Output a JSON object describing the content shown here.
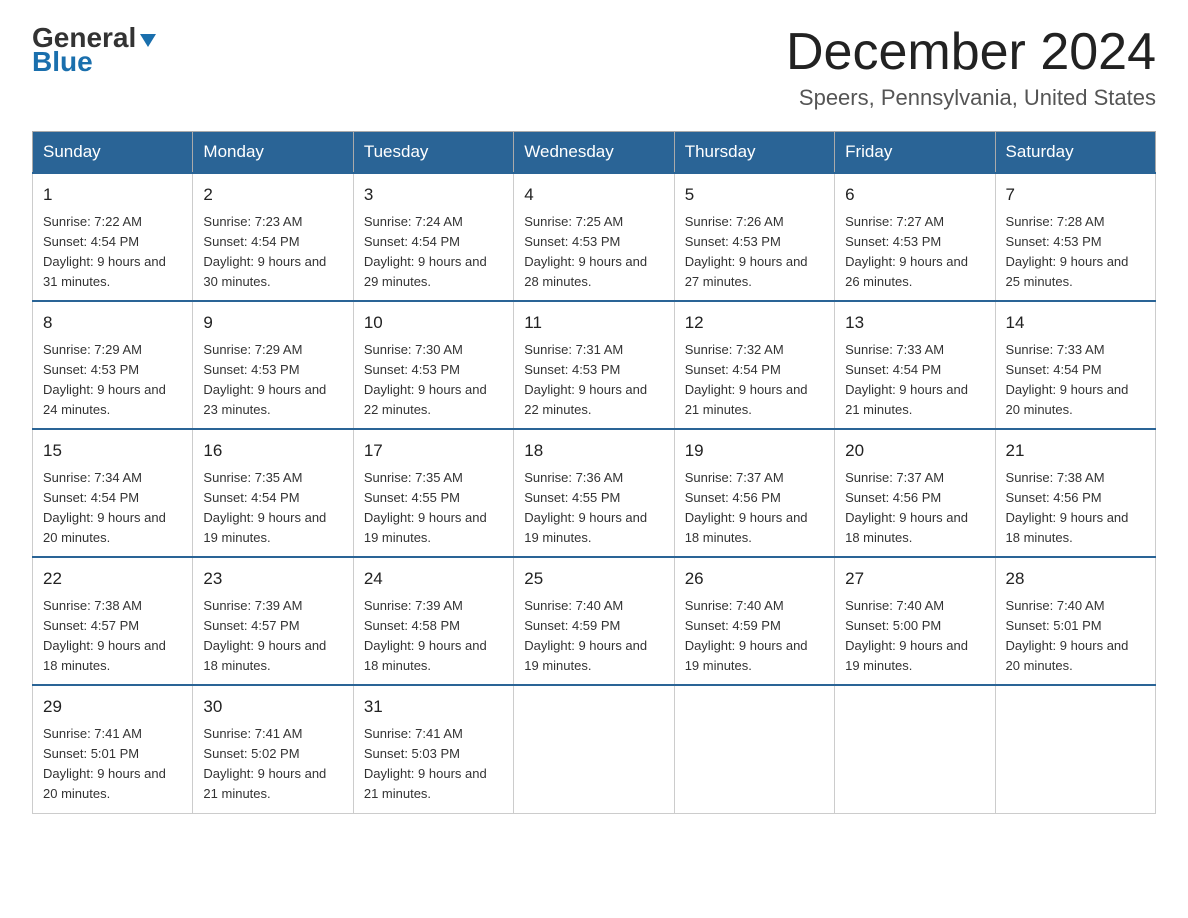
{
  "logo": {
    "general": "General",
    "blue": "Blue",
    "arrow": "▼"
  },
  "title": "December 2024",
  "location": "Speers, Pennsylvania, United States",
  "days_of_week": [
    "Sunday",
    "Monday",
    "Tuesday",
    "Wednesday",
    "Thursday",
    "Friday",
    "Saturday"
  ],
  "weeks": [
    [
      {
        "day": "1",
        "sunrise": "Sunrise: 7:22 AM",
        "sunset": "Sunset: 4:54 PM",
        "daylight": "Daylight: 9 hours and 31 minutes."
      },
      {
        "day": "2",
        "sunrise": "Sunrise: 7:23 AM",
        "sunset": "Sunset: 4:54 PM",
        "daylight": "Daylight: 9 hours and 30 minutes."
      },
      {
        "day": "3",
        "sunrise": "Sunrise: 7:24 AM",
        "sunset": "Sunset: 4:54 PM",
        "daylight": "Daylight: 9 hours and 29 minutes."
      },
      {
        "day": "4",
        "sunrise": "Sunrise: 7:25 AM",
        "sunset": "Sunset: 4:53 PM",
        "daylight": "Daylight: 9 hours and 28 minutes."
      },
      {
        "day": "5",
        "sunrise": "Sunrise: 7:26 AM",
        "sunset": "Sunset: 4:53 PM",
        "daylight": "Daylight: 9 hours and 27 minutes."
      },
      {
        "day": "6",
        "sunrise": "Sunrise: 7:27 AM",
        "sunset": "Sunset: 4:53 PM",
        "daylight": "Daylight: 9 hours and 26 minutes."
      },
      {
        "day": "7",
        "sunrise": "Sunrise: 7:28 AM",
        "sunset": "Sunset: 4:53 PM",
        "daylight": "Daylight: 9 hours and 25 minutes."
      }
    ],
    [
      {
        "day": "8",
        "sunrise": "Sunrise: 7:29 AM",
        "sunset": "Sunset: 4:53 PM",
        "daylight": "Daylight: 9 hours and 24 minutes."
      },
      {
        "day": "9",
        "sunrise": "Sunrise: 7:29 AM",
        "sunset": "Sunset: 4:53 PM",
        "daylight": "Daylight: 9 hours and 23 minutes."
      },
      {
        "day": "10",
        "sunrise": "Sunrise: 7:30 AM",
        "sunset": "Sunset: 4:53 PM",
        "daylight": "Daylight: 9 hours and 22 minutes."
      },
      {
        "day": "11",
        "sunrise": "Sunrise: 7:31 AM",
        "sunset": "Sunset: 4:53 PM",
        "daylight": "Daylight: 9 hours and 22 minutes."
      },
      {
        "day": "12",
        "sunrise": "Sunrise: 7:32 AM",
        "sunset": "Sunset: 4:54 PM",
        "daylight": "Daylight: 9 hours and 21 minutes."
      },
      {
        "day": "13",
        "sunrise": "Sunrise: 7:33 AM",
        "sunset": "Sunset: 4:54 PM",
        "daylight": "Daylight: 9 hours and 21 minutes."
      },
      {
        "day": "14",
        "sunrise": "Sunrise: 7:33 AM",
        "sunset": "Sunset: 4:54 PM",
        "daylight": "Daylight: 9 hours and 20 minutes."
      }
    ],
    [
      {
        "day": "15",
        "sunrise": "Sunrise: 7:34 AM",
        "sunset": "Sunset: 4:54 PM",
        "daylight": "Daylight: 9 hours and 20 minutes."
      },
      {
        "day": "16",
        "sunrise": "Sunrise: 7:35 AM",
        "sunset": "Sunset: 4:54 PM",
        "daylight": "Daylight: 9 hours and 19 minutes."
      },
      {
        "day": "17",
        "sunrise": "Sunrise: 7:35 AM",
        "sunset": "Sunset: 4:55 PM",
        "daylight": "Daylight: 9 hours and 19 minutes."
      },
      {
        "day": "18",
        "sunrise": "Sunrise: 7:36 AM",
        "sunset": "Sunset: 4:55 PM",
        "daylight": "Daylight: 9 hours and 19 minutes."
      },
      {
        "day": "19",
        "sunrise": "Sunrise: 7:37 AM",
        "sunset": "Sunset: 4:56 PM",
        "daylight": "Daylight: 9 hours and 18 minutes."
      },
      {
        "day": "20",
        "sunrise": "Sunrise: 7:37 AM",
        "sunset": "Sunset: 4:56 PM",
        "daylight": "Daylight: 9 hours and 18 minutes."
      },
      {
        "day": "21",
        "sunrise": "Sunrise: 7:38 AM",
        "sunset": "Sunset: 4:56 PM",
        "daylight": "Daylight: 9 hours and 18 minutes."
      }
    ],
    [
      {
        "day": "22",
        "sunrise": "Sunrise: 7:38 AM",
        "sunset": "Sunset: 4:57 PM",
        "daylight": "Daylight: 9 hours and 18 minutes."
      },
      {
        "day": "23",
        "sunrise": "Sunrise: 7:39 AM",
        "sunset": "Sunset: 4:57 PM",
        "daylight": "Daylight: 9 hours and 18 minutes."
      },
      {
        "day": "24",
        "sunrise": "Sunrise: 7:39 AM",
        "sunset": "Sunset: 4:58 PM",
        "daylight": "Daylight: 9 hours and 18 minutes."
      },
      {
        "day": "25",
        "sunrise": "Sunrise: 7:40 AM",
        "sunset": "Sunset: 4:59 PM",
        "daylight": "Daylight: 9 hours and 19 minutes."
      },
      {
        "day": "26",
        "sunrise": "Sunrise: 7:40 AM",
        "sunset": "Sunset: 4:59 PM",
        "daylight": "Daylight: 9 hours and 19 minutes."
      },
      {
        "day": "27",
        "sunrise": "Sunrise: 7:40 AM",
        "sunset": "Sunset: 5:00 PM",
        "daylight": "Daylight: 9 hours and 19 minutes."
      },
      {
        "day": "28",
        "sunrise": "Sunrise: 7:40 AM",
        "sunset": "Sunset: 5:01 PM",
        "daylight": "Daylight: 9 hours and 20 minutes."
      }
    ],
    [
      {
        "day": "29",
        "sunrise": "Sunrise: 7:41 AM",
        "sunset": "Sunset: 5:01 PM",
        "daylight": "Daylight: 9 hours and 20 minutes."
      },
      {
        "day": "30",
        "sunrise": "Sunrise: 7:41 AM",
        "sunset": "Sunset: 5:02 PM",
        "daylight": "Daylight: 9 hours and 21 minutes."
      },
      {
        "day": "31",
        "sunrise": "Sunrise: 7:41 AM",
        "sunset": "Sunset: 5:03 PM",
        "daylight": "Daylight: 9 hours and 21 minutes."
      },
      null,
      null,
      null,
      null
    ]
  ]
}
